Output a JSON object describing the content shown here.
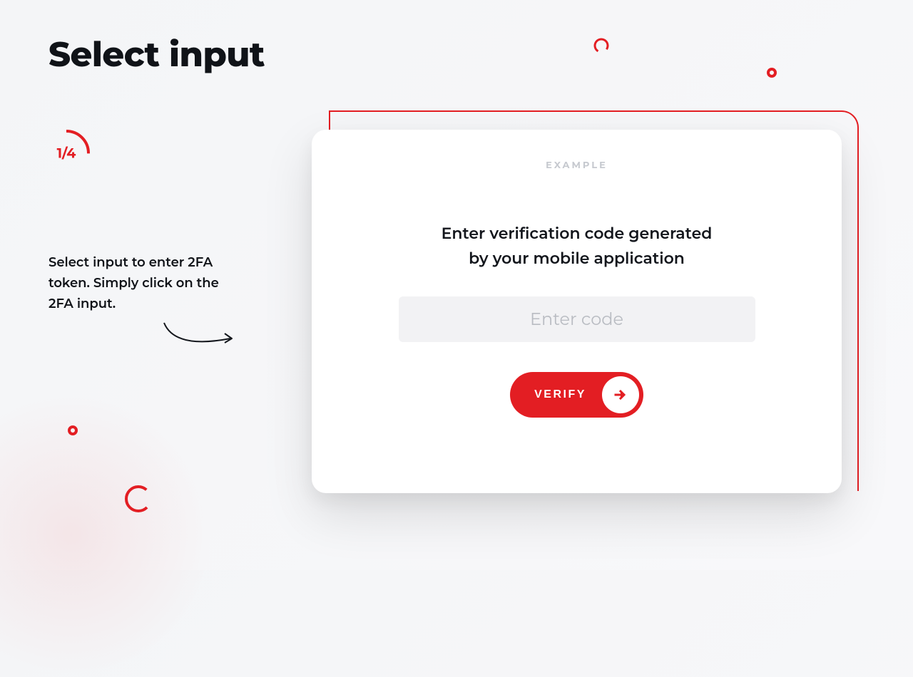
{
  "page": {
    "title": "Select input"
  },
  "step": {
    "label": "1/4",
    "instruction": "Select input to enter 2FA token. Simply click on the 2FA input."
  },
  "card": {
    "badge": "EXAMPLE",
    "heading_line1": "Enter verification code generated",
    "heading_line2": "by your mobile application",
    "input_placeholder": "Enter code",
    "verify_label": "VERIFY"
  },
  "colors": {
    "accent": "#e31e23"
  }
}
